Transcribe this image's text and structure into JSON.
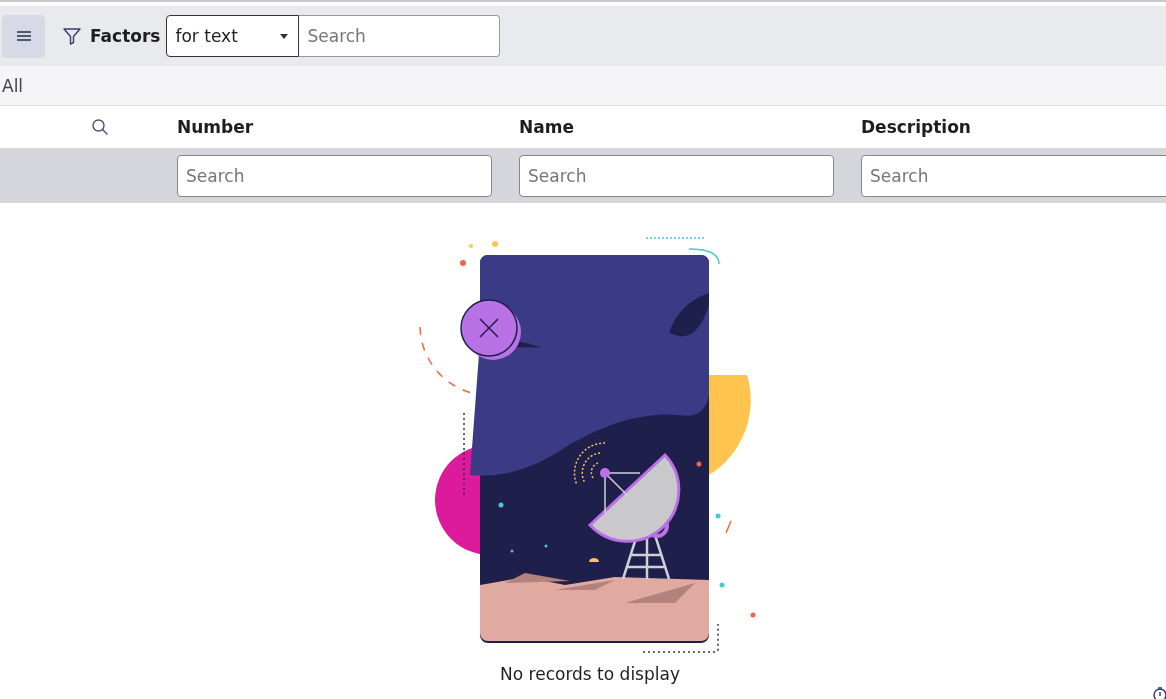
{
  "toolbar": {
    "title": "Factors",
    "search_mode": "for text",
    "search": {
      "placeholder": "Search"
    }
  },
  "breadcrumb": "All",
  "table": {
    "columns": [
      {
        "label": "Number",
        "filter": {
          "placeholder": "Search"
        }
      },
      {
        "label": "Name",
        "filter": {
          "placeholder": "Search"
        }
      },
      {
        "label": "Description",
        "filter": {
          "placeholder": "Search"
        }
      }
    ]
  },
  "empty_message": "No records to display"
}
